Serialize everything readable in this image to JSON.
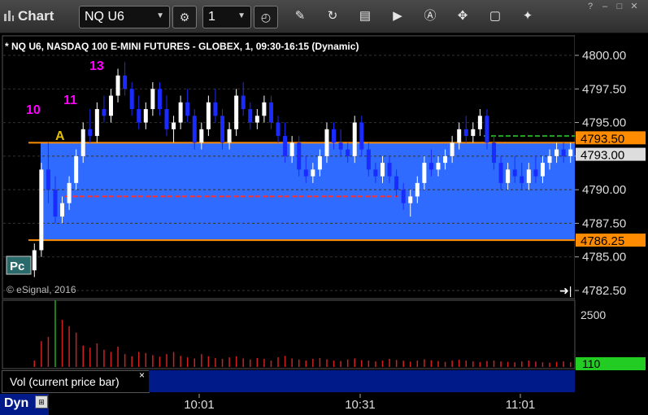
{
  "window": {
    "app_name": "Chart",
    "symbol": "NQ U6",
    "interval": "1"
  },
  "toolbar": {
    "icons": [
      "settings-icon",
      "clock-icon",
      "pencil-icon",
      "refresh-icon",
      "get-icon",
      "play-icon",
      "alert-icon",
      "tools-icon",
      "chat-icon",
      "twitter-icon"
    ]
  },
  "window_controls": [
    "help",
    "minimize",
    "maximize",
    "close"
  ],
  "chart_info": "* NQ U6, NASDAQ 100 E-MINI FUTURES - GLOBEX, 1, 09:30-16:15 (Dynamic)",
  "copyright": "© eSignal, 2016",
  "volume_panel": {
    "tab_label": "Vol (current price bar)",
    "close": "×",
    "axis": [
      "2500"
    ],
    "current": "110"
  },
  "status": {
    "mode": "Dyn"
  },
  "colors": {
    "up": "#ffffff",
    "down": "#1a2bff",
    "range_fill": "#2f6bff",
    "range_line": "#ff8c00",
    "volume": "#d02020",
    "volume_high": "#22aa22",
    "marker_green": "#22aa22",
    "marker_magenta": "#ff00ff"
  },
  "chart_data": {
    "type": "candlestick",
    "title": "* NQ U6, NASDAQ 100 E-MINI FUTURES - GLOBEX, 1, 09:30-16:15 (Dynamic)",
    "y_axis": {
      "ticks": [
        "4800.00",
        "4797.50",
        "4795.00",
        "4792.50",
        "4790.00",
        "4787.50",
        "4785.00",
        "4782.50"
      ],
      "range": [
        4782.5,
        4800.0
      ]
    },
    "x_axis": {
      "ticks": [
        "10:01",
        "10:31",
        "11:01"
      ]
    },
    "price_labels": [
      {
        "value": "4793.50",
        "label": "4793.50",
        "color": "#ff8c00"
      },
      {
        "value": "4793.00",
        "label": "4793.00",
        "color": "#dddddd"
      },
      {
        "value": "4786.25",
        "label": "4786.25",
        "color": "#ff8c00"
      }
    ],
    "opening_range": {
      "high": 4793.5,
      "low": 4786.25
    },
    "levels": [
      {
        "name": "red-dashed",
        "value": 4789.5
      },
      {
        "name": "green-dashed",
        "value": 4794.0
      }
    ],
    "markers": [
      {
        "text": "10",
        "color": "#ff00ff"
      },
      {
        "text": "11",
        "color": "#ff00ff"
      },
      {
        "text": "13",
        "color": "#ff00ff"
      },
      {
        "text": "A",
        "color": "#e0c000"
      }
    ],
    "candles": [
      [
        4784,
        4786,
        4783.5,
        4785.5
      ],
      [
        4785.5,
        4792,
        4785,
        4791.5
      ],
      [
        4791.5,
        4793.5,
        4789,
        4790
      ],
      [
        4790,
        4791,
        4787.5,
        4788
      ],
      [
        4788,
        4789.5,
        4787.5,
        4789
      ],
      [
        4789,
        4791,
        4788.5,
        4790.5
      ],
      [
        4790.5,
        4793,
        4790,
        4792.5
      ],
      [
        4792.5,
        4795,
        4792,
        4794.5
      ],
      [
        4794.5,
        4796,
        4793.5,
        4794
      ],
      [
        4794,
        4796.5,
        4793.5,
        4796
      ],
      [
        4796,
        4797,
        4795,
        4795.5
      ],
      [
        4795.5,
        4797.5,
        4795,
        4797
      ],
      [
        4797,
        4799,
        4796.5,
        4798.5
      ],
      [
        4798.5,
        4799.5,
        4797,
        4797.5
      ],
      [
        4797.5,
        4798,
        4795.5,
        4796
      ],
      [
        4796,
        4797,
        4794.5,
        4795
      ],
      [
        4795,
        4796.5,
        4794.5,
        4796
      ],
      [
        4796,
        4798,
        4795.5,
        4797.5
      ],
      [
        4797.5,
        4798,
        4795.5,
        4796
      ],
      [
        4796,
        4797,
        4794,
        4794.5
      ],
      [
        4794.5,
        4795.5,
        4793.5,
        4795
      ],
      [
        4795,
        4797,
        4794.5,
        4796.5
      ],
      [
        4796.5,
        4797.5,
        4795,
        4795.5
      ],
      [
        4795.5,
        4796,
        4793,
        4793.5
      ],
      [
        4793.5,
        4795,
        4793,
        4794.5
      ],
      [
        4794.5,
        4797,
        4794,
        4796.5
      ],
      [
        4796.5,
        4797.5,
        4795,
        4795.5
      ],
      [
        4795.5,
        4796,
        4793,
        4793.5
      ],
      [
        4793.5,
        4795,
        4793,
        4794.5
      ],
      [
        4794.5,
        4797.5,
        4794,
        4797
      ],
      [
        4797,
        4798,
        4795.5,
        4796
      ],
      [
        4796,
        4796.5,
        4794.5,
        4795
      ],
      [
        4795,
        4796,
        4794.5,
        4795.5
      ],
      [
        4795.5,
        4797,
        4795,
        4796.5
      ],
      [
        4796.5,
        4797,
        4794.5,
        4795
      ],
      [
        4795,
        4795.5,
        4793.5,
        4794
      ],
      [
        4794,
        4795,
        4792,
        4792.5
      ],
      [
        4792.5,
        4794,
        4792,
        4793.5
      ],
      [
        4793.5,
        4794,
        4791,
        4791.5
      ],
      [
        4791.5,
        4792.5,
        4790.5,
        4791
      ],
      [
        4791,
        4792,
        4790.5,
        4791.5
      ],
      [
        4791.5,
        4793,
        4791,
        4792.5
      ],
      [
        4792.5,
        4795,
        4792,
        4794.5
      ],
      [
        4794.5,
        4795,
        4793,
        4793.5
      ],
      [
        4793.5,
        4794.5,
        4792.5,
        4793
      ],
      [
        4793,
        4793.5,
        4792,
        4792.5
      ],
      [
        4792.5,
        4795.5,
        4792,
        4795
      ],
      [
        4795,
        4795.5,
        4792.5,
        4793
      ],
      [
        4793,
        4793.5,
        4791,
        4791.5
      ],
      [
        4791.5,
        4792,
        4790.5,
        4791
      ],
      [
        4791,
        4792.5,
        4790.5,
        4792
      ],
      [
        4792,
        4792.5,
        4790.5,
        4791
      ],
      [
        4791,
        4791.5,
        4789.5,
        4790
      ],
      [
        4790,
        4790.5,
        4788.5,
        4789
      ],
      [
        4789,
        4790,
        4788,
        4789.5
      ],
      [
        4789.5,
        4791,
        4789,
        4790.5
      ],
      [
        4790.5,
        4792.5,
        4790,
        4792
      ],
      [
        4792,
        4793,
        4791,
        4791.5
      ],
      [
        4791.5,
        4792.5,
        4791,
        4792
      ],
      [
        4792,
        4793,
        4791.5,
        4792.5
      ],
      [
        4792.5,
        4794,
        4792,
        4793.5
      ],
      [
        4793.5,
        4795,
        4793,
        4794.5
      ],
      [
        4794.5,
        4795.5,
        4793.5,
        4794
      ],
      [
        4794,
        4795,
        4793.5,
        4794.5
      ],
      [
        4794.5,
        4796,
        4794,
        4795.5
      ],
      [
        4795.5,
        4796,
        4793,
        4793.5
      ],
      [
        4793.5,
        4794,
        4791.5,
        4792
      ],
      [
        4792,
        4792.5,
        4790,
        4790.5
      ],
      [
        4790.5,
        4792,
        4790,
        4791.5
      ],
      [
        4791.5,
        4792.5,
        4790.5,
        4791
      ],
      [
        4791,
        4792,
        4790,
        4790.5
      ],
      [
        4790.5,
        4792,
        4790,
        4791.5
      ],
      [
        4791.5,
        4792.5,
        4790.5,
        4791
      ],
      [
        4791,
        4792.5,
        4790.5,
        4792
      ],
      [
        4792,
        4793,
        4791.5,
        4792.5
      ],
      [
        4792.5,
        4793.5,
        4792,
        4793
      ],
      [
        4793,
        4793.5,
        4792,
        4792.5
      ],
      [
        4792.5,
        4793.5,
        4792,
        4793
      ]
    ],
    "volume": {
      "ylim": [
        0,
        2500
      ],
      "values": [
        300,
        1200,
        1400,
        3100,
        2200,
        1900,
        1600,
        1000,
        900,
        1100,
        800,
        700,
        950,
        600,
        500,
        700,
        650,
        550,
        480,
        600,
        700,
        520,
        450,
        400,
        600,
        500,
        420,
        380,
        450,
        500,
        400,
        350,
        420,
        380,
        300,
        450,
        520,
        400,
        350,
        300,
        380,
        420,
        360,
        300,
        280,
        350,
        400,
        320,
        300,
        260,
        300,
        380,
        330,
        290,
        250,
        300,
        360,
        310,
        280,
        240,
        300,
        340,
        300,
        260,
        230,
        280,
        300,
        260,
        240,
        220,
        260,
        300,
        250,
        220,
        200,
        240,
        260,
        220
      ]
    }
  }
}
